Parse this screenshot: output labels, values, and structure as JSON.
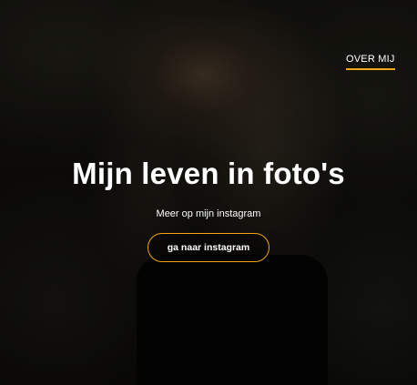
{
  "nav": {
    "over_mij": "OVER MIJ"
  },
  "hero": {
    "title": "Mijn leven in foto's",
    "subtitle": "Meer op mijn instagram",
    "button_label": "ga naar instagram"
  },
  "colors": {
    "accent": "#f0a51c",
    "text": "#ffffff",
    "overlay": "#0b0a08"
  }
}
